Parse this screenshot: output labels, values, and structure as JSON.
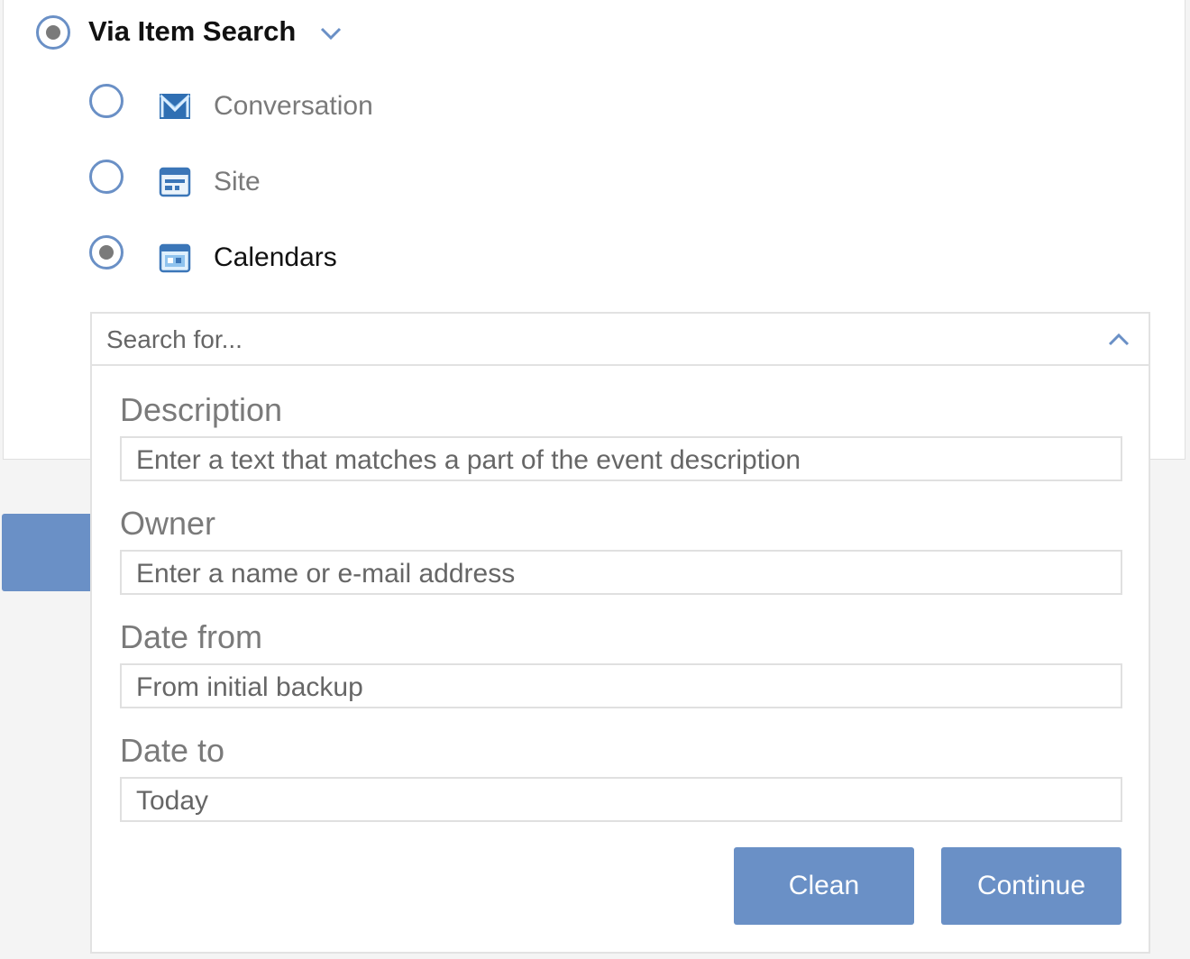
{
  "restore_mode": {
    "label": "Via Item Search",
    "selected": true
  },
  "item_types": [
    {
      "label": "Conversation",
      "icon": "mail-icon",
      "selected": false
    },
    {
      "label": "Site",
      "icon": "site-icon",
      "selected": false
    },
    {
      "label": "Calendars",
      "icon": "calendar-icon",
      "selected": true
    }
  ],
  "search": {
    "placeholder": "Search for...",
    "expanded": true
  },
  "fields": {
    "description": {
      "label": "Description",
      "placeholder": "Enter a text that matches a part of the event description"
    },
    "owner": {
      "label": "Owner",
      "placeholder": "Enter a name or e-mail address"
    },
    "date_from": {
      "label": "Date from",
      "value": "From initial backup"
    },
    "date_to": {
      "label": "Date to",
      "value": "Today"
    }
  },
  "buttons": {
    "clean": "Clean",
    "continue": "Continue"
  },
  "colors": {
    "accent": "#6a90c6",
    "selected_dot": "#7a7a7a"
  }
}
